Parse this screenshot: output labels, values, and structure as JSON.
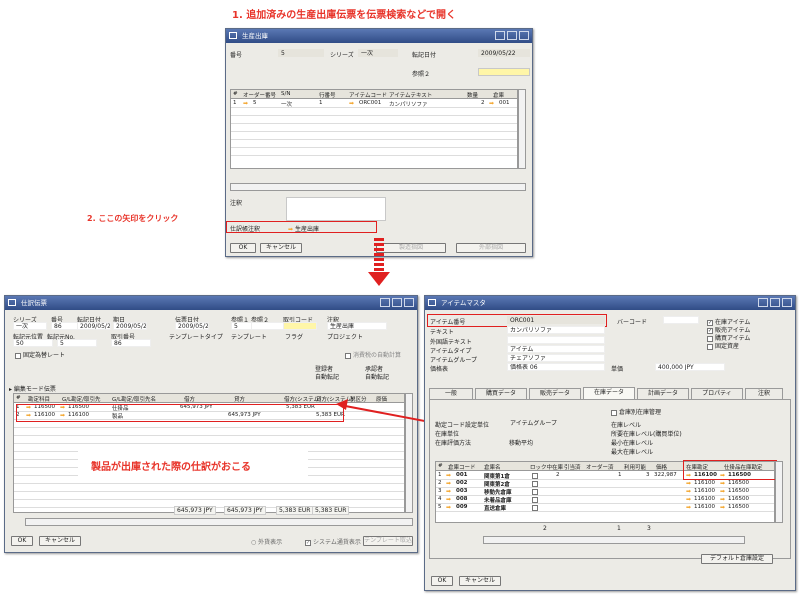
{
  "annotations": {
    "step1": "1. 追加済みの生産出庫伝票を伝票検索などで開く",
    "step2": "2. ここの矢印をクリック",
    "journal": "製品が出庫された際の仕訳がおこる"
  },
  "prod": {
    "title": "生産出庫",
    "fields": {
      "number_label": "番号",
      "number": "5",
      "series_label": "シリーズ",
      "series": "一次",
      "posting_label": "転記日付",
      "posting": "2009/05/22",
      "ref2_label": "参照２"
    },
    "grid": {
      "headers": [
        "#",
        "オーダー番号",
        "S/N",
        "行番号",
        "アイテムコード",
        "アイテムテキスト",
        "数量",
        "倉庫"
      ],
      "row": {
        "no": "1",
        "order": "5",
        "sn": "一次",
        "line": "1",
        "item": "ORC001",
        "text": "カンパリソファ",
        "qty": "2",
        "wh": "001"
      }
    },
    "remarks_label": "注釈",
    "journal_label": "仕訳帳注釈",
    "journal_value": "生産出庫",
    "ok": "OK",
    "cancel": "キャンセル",
    "btn3": "製造指図",
    "btn4": "外部指図"
  },
  "journal": {
    "title": "仕訳伝票",
    "header_labels": [
      "シリーズ",
      "番号",
      "転記日付",
      "期日",
      "伝票日付",
      "参照１",
      "参照２",
      "取引コード",
      "注釈"
    ],
    "header_values": [
      "一次",
      "86",
      "2009/05/22",
      "2009/05/22",
      "2009/05/22",
      "5",
      "",
      "",
      "生産出庫"
    ],
    "row2_labels": [
      "転記元位置",
      "転記元No.",
      "取引番号",
      "テンプレートタイプ",
      "テンプレート",
      "フラグ",
      "プロジェクト"
    ],
    "row2_values": [
      "50",
      "5",
      "86"
    ],
    "fixed_label": "固定為替レート",
    "reverse_label": "消費税の自動計算",
    "approve_labels": [
      "登録者",
      "承認者"
    ],
    "approve_values": [
      "自動転記",
      "自動転記"
    ],
    "section_label": "編集モード伝票",
    "grid_headers": [
      "#",
      "勘定科目",
      "G/L勘定/取引先",
      "G/L勘定/取引先名",
      "借方",
      "貸方",
      "借方(システム)",
      "貸方(システム)",
      "税区分",
      "原価"
    ],
    "rows": [
      {
        "no": "1",
        "acct": "116500",
        "gl": "116500",
        "name": "仕掛品",
        "debit": "645,973 JPY",
        "credit": "",
        "dsys": "5,383 EUR",
        "csys": ""
      },
      {
        "no": "2",
        "acct": "116100",
        "gl": "116100",
        "name": "製品",
        "debit": "",
        "credit": "645,973 JPY",
        "dsys": "",
        "csys": "5,383 EUR"
      }
    ],
    "totals": [
      "645,973 JPY",
      "645,973 JPY",
      "5,383 EUR",
      "5,383 EUR"
    ],
    "ok": "OK",
    "cancel": "キャンセル",
    "foreign": "外貨表示",
    "system": "システム通貨表示",
    "template_btn": "テンプレート取込"
  },
  "item": {
    "title": "アイテムマスタ",
    "labels": {
      "item_no": "アイテム番号",
      "desc": "テキスト",
      "foreign": "外国語テキスト",
      "type": "アイテムタイプ",
      "group": "アイテムグループ",
      "price": "価格表",
      "barcode": "バーコード",
      "unit_price": "単価"
    },
    "values": {
      "item_no": "ORC001",
      "desc": "カンパリソファ",
      "type": "アイテム",
      "group": "チェアソファ",
      "price": "価格表 06",
      "unit_price": "400,000 JPY"
    },
    "checks": [
      {
        "label": "在庫アイテム",
        "checked": true
      },
      {
        "label": "販売アイテム",
        "checked": true
      },
      {
        "label": "購買アイテム",
        "checked": false
      },
      {
        "label": "固定資産",
        "checked": false
      }
    ],
    "tabs": [
      "一般",
      "購買データ",
      "販売データ",
      "在庫データ",
      "計画データ",
      "プロパティ",
      "注釈"
    ],
    "inv": {
      "wh_manage": "倉庫別在庫管理",
      "gl_set": "勘定コード設定単位",
      "gl_value": "アイテムグループ",
      "val_method": "在庫評価方法",
      "val_value": "移動平均",
      "uom": "在庫単位",
      "weight": "在庫重量",
      "req": "在庫レベル",
      "req_uom": "所要在庫レベル(購買単位)",
      "min": "最小在庫レベル",
      "max": "最大在庫レベル"
    },
    "grid_headers": [
      "#",
      "倉庫コード",
      "倉庫名",
      "ロック中",
      "在庫",
      "引当済",
      "オーダー済",
      "利用可能",
      "価格",
      "在庫勘定",
      "仕掛品在庫勘定"
    ],
    "rows": [
      {
        "no": "1",
        "code": "001",
        "name": "関東第1倉",
        "instock": "2",
        "committed": "",
        "ordered": "1",
        "avail": "3",
        "price": "322,987",
        "inv": "116100",
        "wip": "116500"
      },
      {
        "no": "2",
        "code": "002",
        "name": "関東第2倉",
        "instock": "",
        "committed": "",
        "ordered": "",
        "avail": "",
        "price": "",
        "inv": "116100",
        "wip": "116500"
      },
      {
        "no": "3",
        "code": "003",
        "name": "移動先倉庫",
        "instock": "",
        "committed": "",
        "ordered": "",
        "avail": "",
        "price": "",
        "inv": "116100",
        "wip": "116500"
      },
      {
        "no": "4",
        "code": "008",
        "name": "未着品倉庫",
        "instock": "",
        "committed": "",
        "ordered": "",
        "avail": "",
        "price": "",
        "inv": "116100",
        "wip": "116500"
      },
      {
        "no": "5",
        "code": "009",
        "name": "直送倉庫",
        "instock": "",
        "committed": "",
        "ordered": "",
        "avail": "",
        "price": "",
        "inv": "116100",
        "wip": "116500"
      }
    ],
    "totals": {
      "instock": "2",
      "ordered": "1",
      "avail": "3"
    },
    "default_btn": "デフォルト倉庫設定",
    "ok": "OK",
    "cancel": "キャンセル"
  }
}
